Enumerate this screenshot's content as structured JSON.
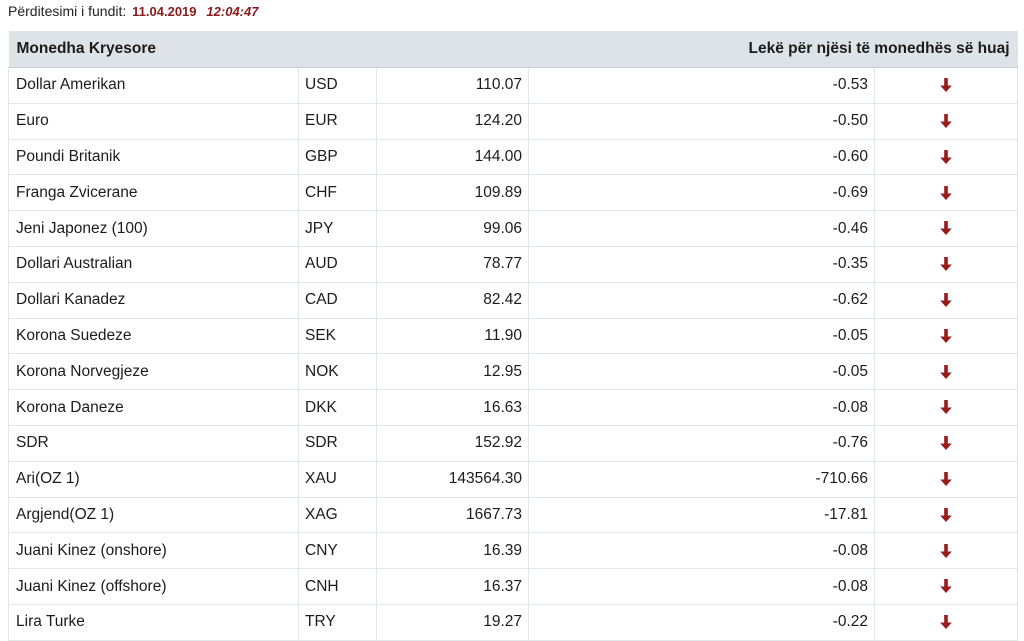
{
  "updated": {
    "label": "Përditesimi i fundit:",
    "date": "11.04.2019",
    "time": "12:04:47"
  },
  "table": {
    "header_main": "Monedha Kryesore",
    "header_rate": "Lekë për njësi të monedhës së huaj",
    "down_color": "#9b1b1b",
    "rows": [
      {
        "name": "Dollar Amerikan",
        "code": "USD",
        "rate": "110.07",
        "change": "-0.53",
        "trend": "down-arrow-icon"
      },
      {
        "name": "Euro",
        "code": "EUR",
        "rate": "124.20",
        "change": "-0.50",
        "trend": "down-arrow-icon"
      },
      {
        "name": "Poundi Britanik",
        "code": "GBP",
        "rate": "144.00",
        "change": "-0.60",
        "trend": "down-arrow-icon"
      },
      {
        "name": "Franga Zvicerane",
        "code": "CHF",
        "rate": "109.89",
        "change": "-0.69",
        "trend": "down-arrow-icon"
      },
      {
        "name": "Jeni Japonez (100)",
        "code": "JPY",
        "rate": "99.06",
        "change": "-0.46",
        "trend": "down-arrow-icon"
      },
      {
        "name": "Dollari Australian",
        "code": "AUD",
        "rate": "78.77",
        "change": "-0.35",
        "trend": "down-arrow-icon"
      },
      {
        "name": "Dollari Kanadez",
        "code": "CAD",
        "rate": "82.42",
        "change": "-0.62",
        "trend": "down-arrow-icon"
      },
      {
        "name": "Korona Suedeze",
        "code": "SEK",
        "rate": "11.90",
        "change": "-0.05",
        "trend": "down-arrow-icon"
      },
      {
        "name": "Korona Norvegjeze",
        "code": "NOK",
        "rate": "12.95",
        "change": "-0.05",
        "trend": "down-arrow-icon"
      },
      {
        "name": "Korona Daneze",
        "code": "DKK",
        "rate": "16.63",
        "change": "-0.08",
        "trend": "down-arrow-icon"
      },
      {
        "name": "SDR",
        "code": "SDR",
        "rate": "152.92",
        "change": "-0.76",
        "trend": "down-arrow-icon"
      },
      {
        "name": "Ari(OZ 1)",
        "code": "XAU",
        "rate": "143564.30",
        "change": "-710.66",
        "trend": "down-arrow-icon"
      },
      {
        "name": "Argjend(OZ 1)",
        "code": "XAG",
        "rate": "1667.73",
        "change": "-17.81",
        "trend": "down-arrow-icon"
      },
      {
        "name": "Juani Kinez (onshore)",
        "code": "CNY",
        "rate": "16.39",
        "change": "-0.08",
        "trend": "down-arrow-icon"
      },
      {
        "name": "Juani Kinez (offshore)",
        "code": "CNH",
        "rate": "16.37",
        "change": "-0.08",
        "trend": "down-arrow-icon"
      },
      {
        "name": "Lira Turke",
        "code": "TRY",
        "rate": "19.27",
        "change": "-0.22",
        "trend": "down-arrow-icon"
      }
    ]
  }
}
